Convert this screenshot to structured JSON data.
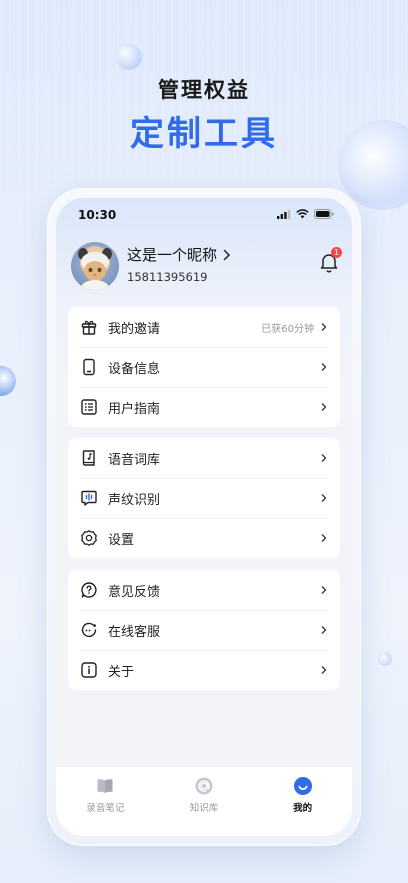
{
  "promo": {
    "headline": "管理权益",
    "subheadline": "定制工具"
  },
  "status_bar": {
    "time": "10:30"
  },
  "profile": {
    "nickname": "这是一个昵称",
    "phone": "15811395619",
    "notification_count": "1"
  },
  "menu_groups": [
    {
      "items": [
        {
          "label": "我的邀请",
          "extra": "已获60分钟",
          "icon": "gift-icon"
        },
        {
          "label": "设备信息",
          "icon": "phone-device-icon"
        },
        {
          "label": "用户指南",
          "icon": "list-guide-icon"
        }
      ]
    },
    {
      "items": [
        {
          "label": "语音词库",
          "icon": "music-book-icon"
        },
        {
          "label": "声纹识别",
          "icon": "voiceprint-icon"
        },
        {
          "label": "设置",
          "icon": "gear-icon"
        }
      ]
    },
    {
      "items": [
        {
          "label": "意见反馈",
          "icon": "feedback-icon"
        },
        {
          "label": "在线客服",
          "icon": "customer-service-icon"
        },
        {
          "label": "关于",
          "icon": "info-icon"
        }
      ]
    }
  ],
  "tabbar": {
    "tabs": [
      {
        "label": "录音笔记",
        "icon": "book-icon",
        "active": false
      },
      {
        "label": "知识库",
        "icon": "at-icon",
        "active": false
      },
      {
        "label": "我的",
        "icon": "smile-icon",
        "active": true
      }
    ]
  },
  "colors": {
    "accent": "#2f6bea",
    "badge": "#f04848"
  }
}
